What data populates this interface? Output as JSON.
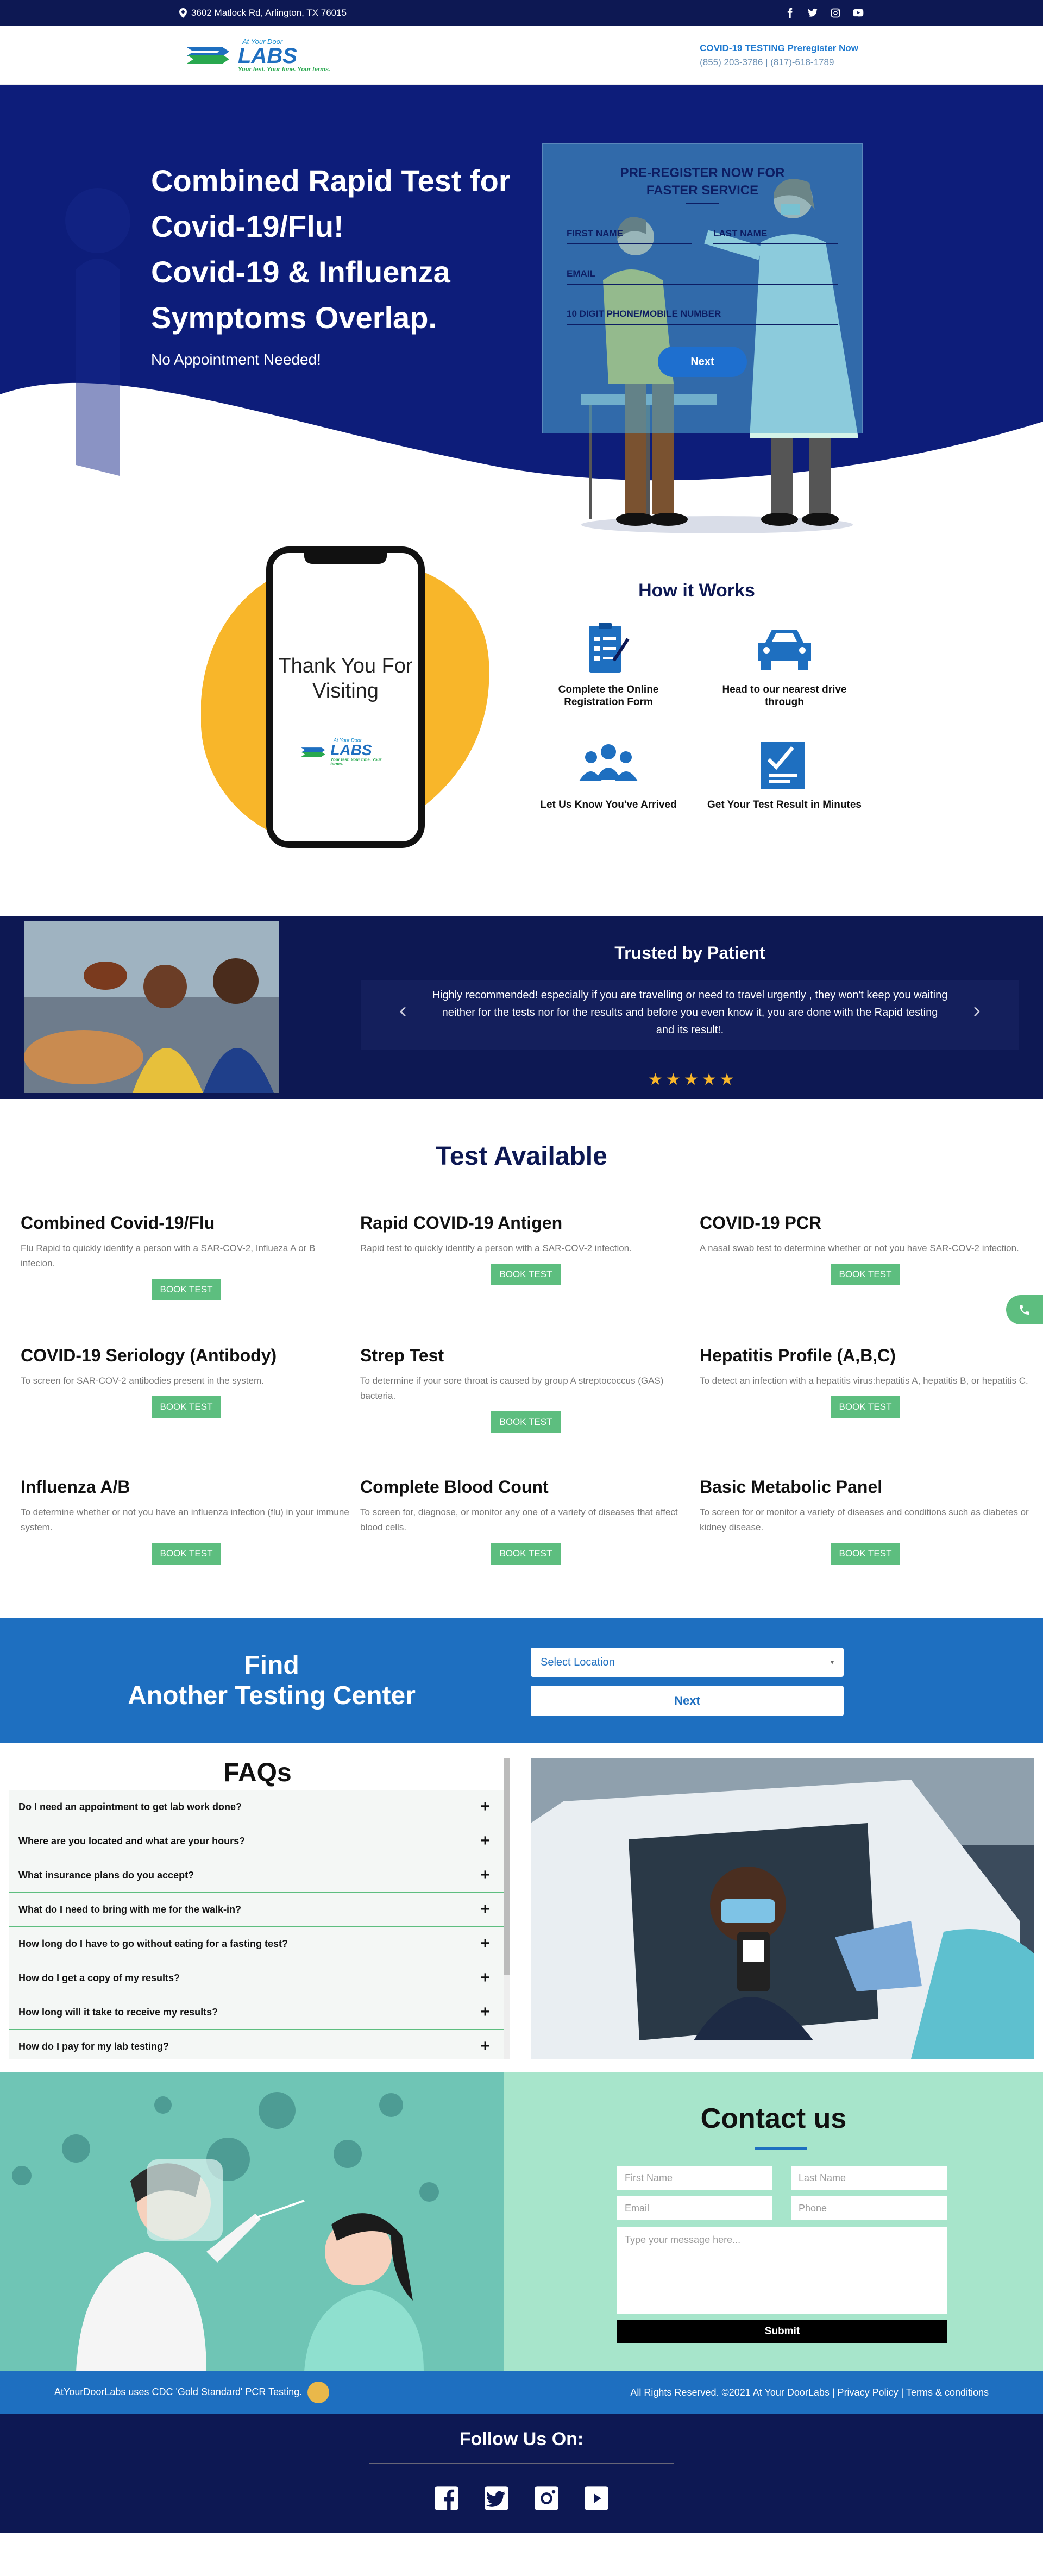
{
  "topbar": {
    "address": "3602 Matlock Rd, Arlington, TX 76015",
    "social": [
      "facebook-icon",
      "twitter-icon",
      "instagram-icon",
      "youtube-icon"
    ]
  },
  "header": {
    "logo_small": "At Your Door",
    "logo_big": "LABS",
    "logo_tag": "Your test. Your time. Your terms.",
    "prereg": "COVID-19 TESTING Preregister Now",
    "phones": "(855) 203-3786  |  (817)-618-1789"
  },
  "hero": {
    "title_lines": [
      "Combined Rapid Test for",
      "Covid-19/Flu!",
      "Covid-19 & Influenza",
      "Symptoms Overlap."
    ],
    "line1": "Combined Rapid Test for",
    "line2": "Covid-19/Flu!",
    "line3": "Covid-19 & Influenza",
    "line4": "Symptoms Overlap.",
    "subtitle": "No Appointment Needed!",
    "form": {
      "heading1": "PRE-REGISTER NOW FOR",
      "heading2": "FASTER SERVICE",
      "first_name": "FIRST NAME",
      "last_name": "LAST NAME",
      "email": "EMAIL",
      "phone": "10 DIGIT PHONE/MOBILE NUMBER",
      "submit": "Next"
    }
  },
  "how": {
    "phone_text1": "Thank You For",
    "phone_text2": "Visiting",
    "title": "How it Works",
    "steps": [
      {
        "label": "Complete the Online Registration Form",
        "icon": "form-icon"
      },
      {
        "label": "Head to our nearest drive through",
        "icon": "car-icon"
      },
      {
        "label": "Let Us Know You've Arrived",
        "icon": "group-icon"
      },
      {
        "label": "Get Your Test Result in Minutes",
        "icon": "checklist-icon"
      }
    ]
  },
  "trusted": {
    "title": "Trusted by Patient",
    "quote": "Highly recommended! especially if you are travelling or need to travel urgently , they won't keep you waiting neither for the tests nor for the results and before you even know it, you are done with the Rapid testing and its result!.",
    "rating": 5
  },
  "tests": {
    "title": "Test Available",
    "button": "BOOK TEST",
    "items": [
      {
        "name": "Combined Covid-19/Flu",
        "desc": "Flu Rapid to quickly identify a person with a SAR-COV-2, Influeza A or B infecion."
      },
      {
        "name": "Rapid COVID-19 Antigen",
        "desc": "Rapid test to quickly identify a person with a SAR-COV-2 infection."
      },
      {
        "name": "COVID-19 PCR",
        "desc": "A nasal swab test to determine whether or not you have SAR-COV-2 infection."
      },
      {
        "name": "COVID-19 Seriology (Antibody)",
        "desc": "To screen for SAR-COV-2 antibodies present in the system."
      },
      {
        "name": "Strep Test",
        "desc": "To determine if your sore throat is caused by group A streptococcus (GAS) bacteria."
      },
      {
        "name": "Hepatitis Profile (A,B,C)",
        "desc": "To detect an infection with a hepatitis virus:hepatitis A, hepatitis B, or hepatitis C."
      },
      {
        "name": "Influenza A/B",
        "desc": "To determine whether or not you have an influenza infection (flu) in your immune system."
      },
      {
        "name": "Complete Blood Count",
        "desc": "To screen for, diagnose, or monitor any one of a variety of diseases that affect blood cells."
      },
      {
        "name": "Basic Metabolic Panel",
        "desc": "To screen for or monitor a variety of diseases and conditions such as diabetes or kidney disease."
      }
    ]
  },
  "find": {
    "title1": "Find",
    "title2": "Another Testing Center",
    "select_placeholder": "Select Location",
    "next": "Next"
  },
  "faq": {
    "title": "FAQs",
    "items": [
      "Do I need an appointment to get lab work done?",
      "Where are you located and what are your hours?",
      "What insurance plans do you accept?",
      "What do I need to bring with me for the walk-in?",
      "How long do I have to go without eating for a fasting test?",
      "How do I get a copy of my results?",
      "How long will it take to receive my results?",
      "How do I pay for my lab testing?"
    ]
  },
  "contact": {
    "title": "Contact us",
    "first": "First Name",
    "last": "Last Name",
    "email": "Email",
    "phone": "Phone",
    "message": "Type your message here...",
    "submit": "Submit"
  },
  "footer": {
    "left": "AtYourDoorLabs uses CDC 'Gold Standard' PCR Testing.",
    "right": "All Rights Reserved. ©2021 At Your DoorLabs | Privacy Policy | Terms & conditions",
    "follow": "Follow Us On:"
  },
  "colors": {
    "navy": "#0d1853",
    "blue": "#1e6fc0",
    "green": "#5dbe7f",
    "yellow": "#f8b62a",
    "mint": "#a7e5cb"
  }
}
